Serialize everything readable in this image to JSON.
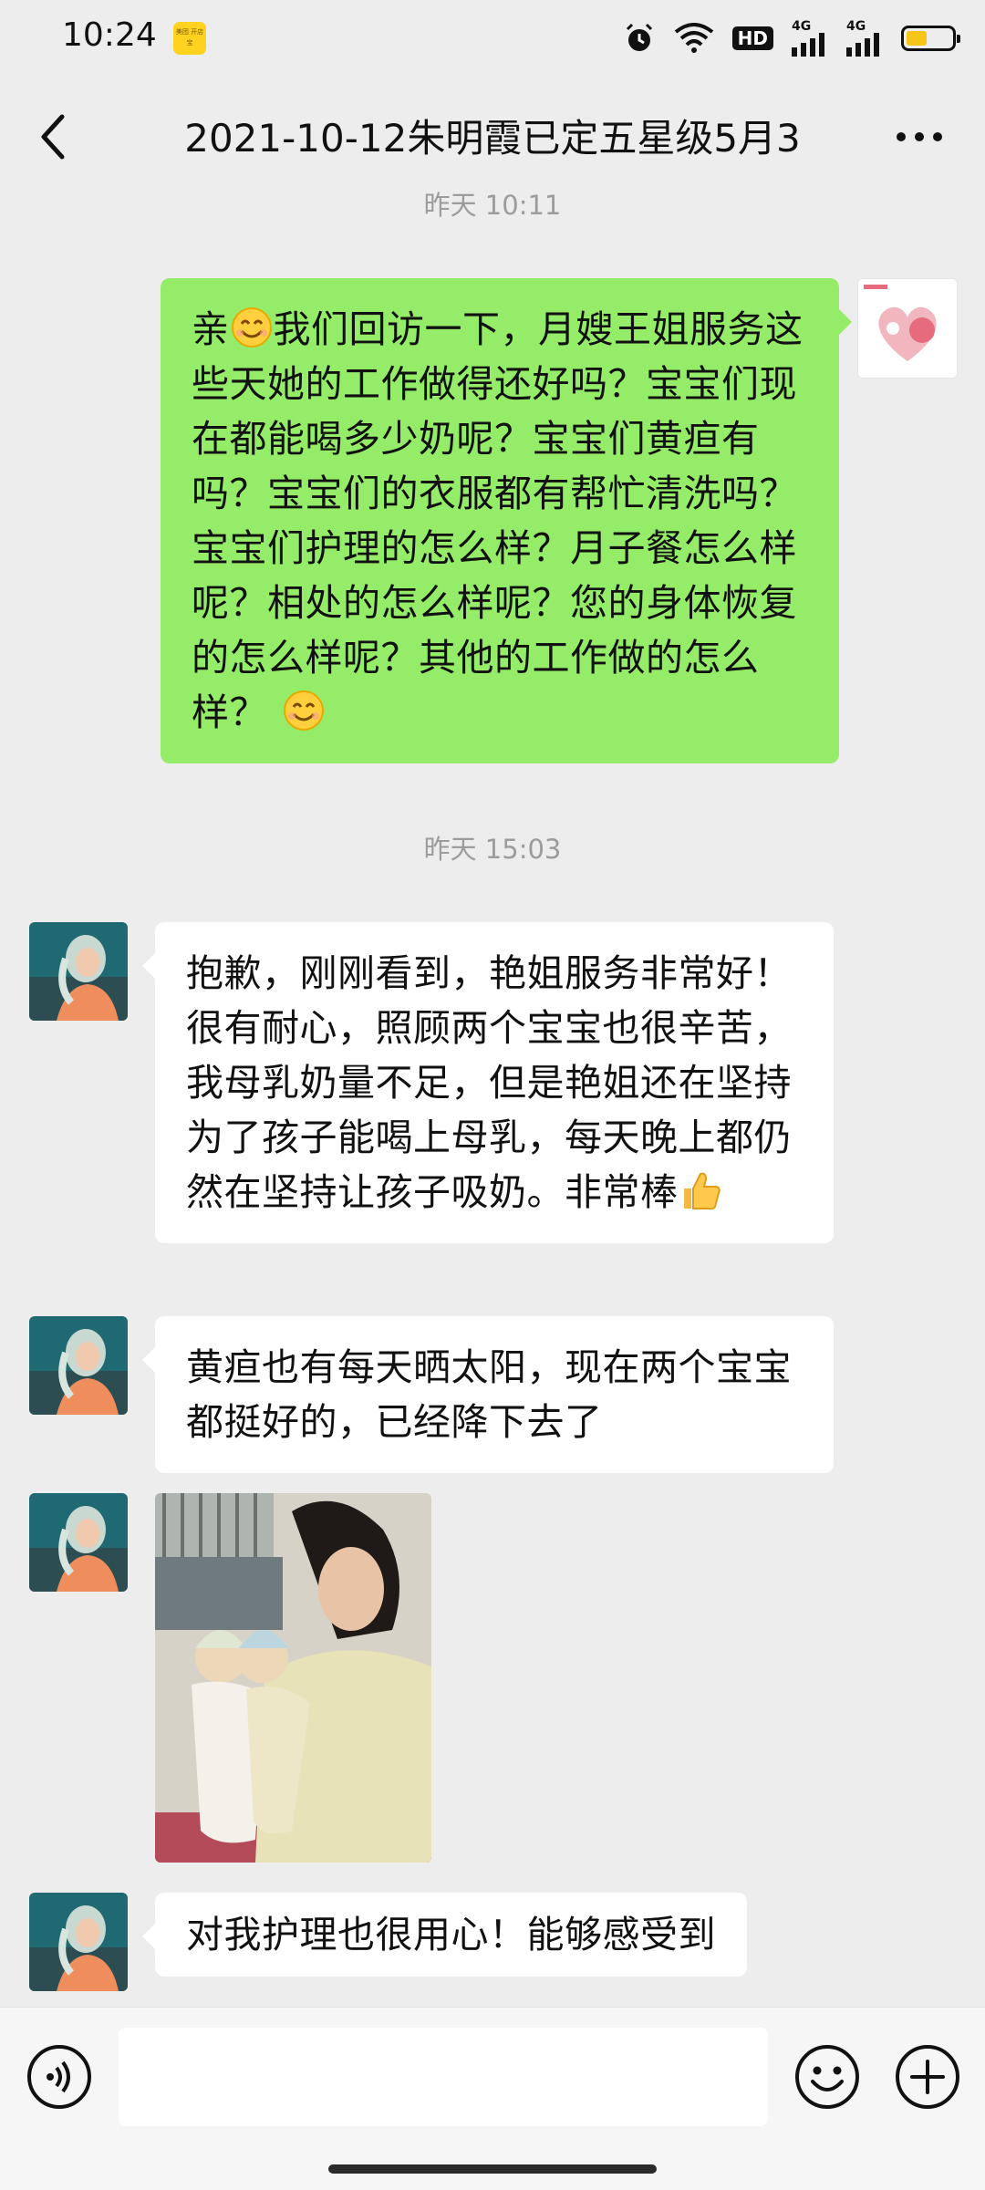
{
  "status_bar": {
    "time": "10:24",
    "badge_text": "美团 开店宝",
    "hd_label": "HD",
    "signal1_label": "4G",
    "signal2_label": "4G",
    "battery_level": 0.45,
    "icons": [
      "alarm-icon",
      "wifi-icon",
      "signal-icon",
      "battery-icon"
    ]
  },
  "header": {
    "title": "2021-10-12朱明霞已定五星级5月3",
    "back_icon": "chevron-left-icon",
    "more_icon": "more-dots-icon"
  },
  "messages": {
    "ts_top": "昨天 10:11",
    "out1": {
      "text_a": "亲",
      "text_b": "我们回访一下，月嫂王姐服务这些天她的工作做得还好吗？宝宝们现在都能喝多少奶呢？宝宝们黄疸有吗？宝宝们的衣服都有帮忙清洗吗？宝宝们护理的怎么样？月子餐怎么样呢？相处的怎么样呢？您的身体恢复的怎么样呢？其他的工作做的怎么样？"
    },
    "ts_mid": "昨天 15:03",
    "in1": {
      "text": "抱歉，刚刚看到，艳姐服务非常好！很有耐心，照顾两个宝宝也很辛苦，我母乳奶量不足，但是艳姐还在坚持为了孩子能喝上母乳，每天晚上都仍然在坚持让孩子吸奶。非常棒"
    },
    "in2": {
      "text": "黄疸也有每天晒太阳，现在两个宝宝都挺好的，已经降下去了"
    },
    "in4": {
      "text": "对我护理也很用心！能够感受到"
    }
  },
  "input_bar": {
    "voice_icon": "voice-icon",
    "emoji_icon": "emoji-icon",
    "add_icon": "plus-icon"
  },
  "colors": {
    "background": "#ededed",
    "outgoing_bubble": "#95ec69",
    "incoming_bubble": "#ffffff",
    "timestamp": "#9c9c9c"
  }
}
